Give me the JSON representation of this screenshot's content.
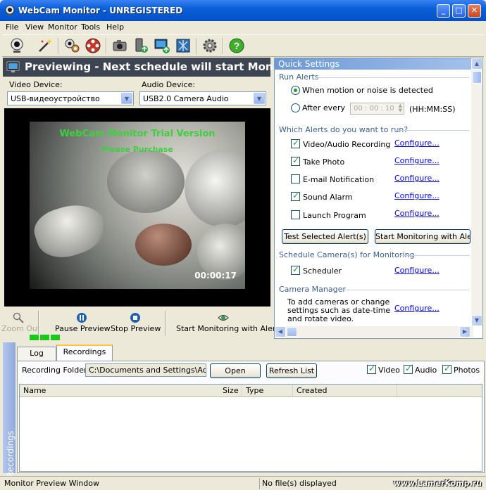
{
  "window": {
    "title": "WebCam Monitor - UNREGISTERED"
  },
  "menu": [
    "File",
    "View",
    "Monitor",
    "Tools",
    "Help"
  ],
  "toolbar_icons": [
    "webcam-icon",
    "magic-wand-icon",
    "cameras-settings-icon",
    "film-reel-icon",
    "snapshot-camera-icon",
    "phone-upload-icon",
    "monitor-upload-icon",
    "network-icon",
    "gear-icon",
    "help-icon"
  ],
  "preview": {
    "header": "Previewing - Next schedule will start Monit...",
    "video_device_label": "Video Device:",
    "video_device_value": "USB-видеоустройство",
    "audio_device_label": "Audio Device:",
    "audio_device_value": "USB2.0 Camera Audio",
    "overlay_title": "WebCam Monitor Trial Version",
    "overlay_sub": "Please Purchase",
    "timestamp": "00:00:17"
  },
  "controls": {
    "zoom_out": "Zoom Out",
    "pause_preview": "Pause Preview",
    "stop_preview": "Stop Preview",
    "start_monitoring": "Start Monitoring with Alerts"
  },
  "quick_settings": {
    "title": "Quick Settings",
    "run_alerts": "Run Alerts",
    "opt_motion": "When motion or noise is detected",
    "opt_after": "After every",
    "interval": "00 : 00 : 10",
    "interval_format": "(HH:MM:SS)",
    "which_alerts": "Which Alerts do you want to run?",
    "alerts": [
      {
        "label": "Video/Audio Recording",
        "checked": true,
        "link": "Configure..."
      },
      {
        "label": "Take Photo",
        "checked": true,
        "link": "Configure..."
      },
      {
        "label": "E-mail Notification",
        "checked": false,
        "link": "Configure..."
      },
      {
        "label": "Sound Alarm",
        "checked": true,
        "link": "Configure..."
      },
      {
        "label": "Launch Program",
        "checked": false,
        "link": "Configure..."
      }
    ],
    "test_button": "Test Selected Alert(s)",
    "start_button": "Start Monitoring with Alert(s)",
    "schedule_title": "Schedule Camera(s) for Monitoring",
    "scheduler_label": "Scheduler",
    "scheduler_link": "Configure...",
    "camera_manager": "Camera Manager",
    "camera_manager_desc": [
      "To add cameras or change",
      "settings such as date-time",
      "and rotate video."
    ],
    "camera_manager_link": "Configure..."
  },
  "recordings": {
    "side_label": "Recordings",
    "tabs": [
      "Log",
      "Recordings"
    ],
    "folder_label": "Recording Folder:",
    "folder_value": "C:\\Documents and Settings\\Admin\\",
    "open_button": "Open",
    "refresh_button": "Refresh List",
    "filters": [
      {
        "label": "Video",
        "checked": true
      },
      {
        "label": "Audio",
        "checked": true
      },
      {
        "label": "Photos",
        "checked": true
      }
    ],
    "columns": [
      "Name",
      "Size",
      "Type",
      "Created"
    ]
  },
  "status": {
    "left": "Monitor Preview Window",
    "right": "No file(s) displayed",
    "watermark": "www.LamerKomp.ru"
  }
}
